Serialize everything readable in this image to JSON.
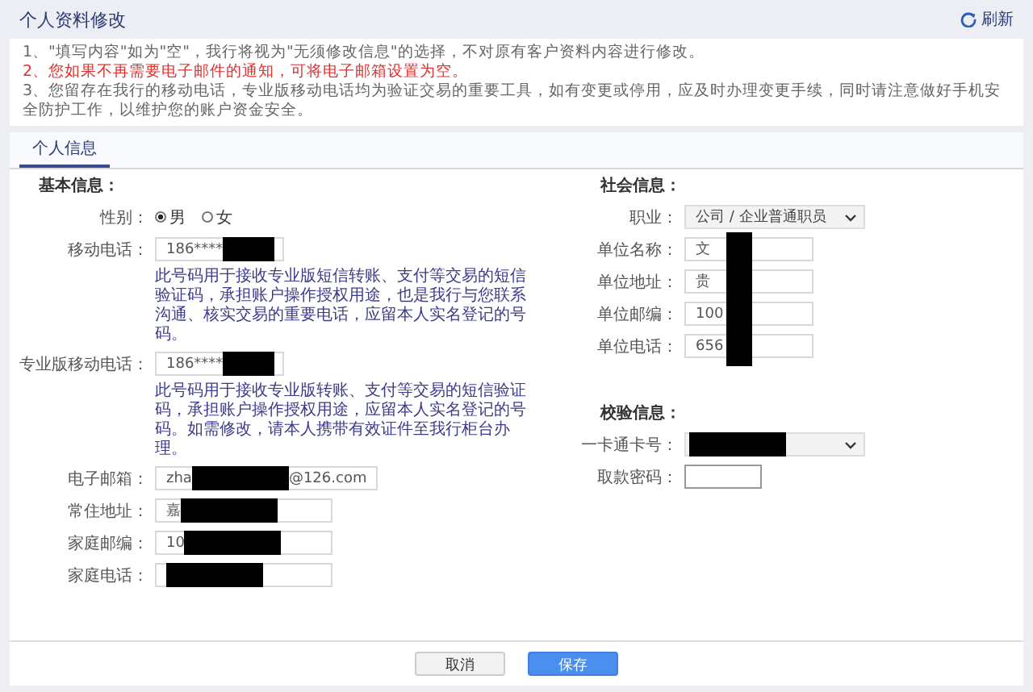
{
  "header": {
    "title": "个人资料修改",
    "refresh": "刷新"
  },
  "notes": [
    {
      "text": "1、\"填写内容\"如为\"空\"，我行将视为\"无须修改信息\"的选择，不对原有客户资料内容进行修改。",
      "kind": "normal"
    },
    {
      "text": "2、您如果不再需要电子邮件的通知，可将电子邮箱设置为空。",
      "kind": "warning"
    },
    {
      "text": "3、您留存在我行的移动电话，专业版移动电话均为验证交易的重要工具，如有变更或停用，应及时办理变更手续，同时请注意做好手机安全防护工作，以维护您的账户资金安全。",
      "kind": "normal"
    }
  ],
  "tabs": [
    {
      "label": "个人信息",
      "selected": true
    }
  ],
  "basic": {
    "heading": "基本信息：",
    "gender": {
      "label": "性别：",
      "options": [
        {
          "label": "男",
          "selected": true
        },
        {
          "label": "女",
          "selected": false
        }
      ]
    },
    "fields": [
      {
        "label": "移动电话：",
        "value": "186****",
        "redacted": true,
        "help": "此号码用于接收专业版短信转账、支付等交易的短信验证码，承担账户操作授权用途，也是我行与您联系沟通、核实交易的重要电话，应留本人实名登记的号码。"
      },
      {
        "label": "专业版移动电话：",
        "value": "186****",
        "redacted": true,
        "help": "此号码用于接收专业版转账、支付等交易的短信验证码，承担账户操作授权用途，应留本人实名登记的号码。如需修改，请本人携带有效证件至我行柜台办理。"
      },
      {
        "label": "电子邮箱：",
        "value": "zha",
        "value_end": "@126.com",
        "redacted": true
      },
      {
        "label": "常住地址：",
        "value": "嘉",
        "redacted": true
      },
      {
        "label": "家庭邮编：",
        "value": "10",
        "redacted": true
      },
      {
        "label": "家庭电话：",
        "redacted": true
      }
    ]
  },
  "social": {
    "heading": "社会信息：",
    "occupation": {
      "label": "职业：",
      "value": "公司 / 企业普通职员"
    },
    "redaction_band": true,
    "fields": [
      {
        "label": "单位名称：",
        "value": "文"
      },
      {
        "label": "单位地址：",
        "value": "贵"
      },
      {
        "label": "单位邮编：",
        "value": "100"
      },
      {
        "label": "单位电话：",
        "value": "656"
      }
    ]
  },
  "verify": {
    "heading": "校验信息：",
    "card": {
      "label": "一卡通卡号：",
      "redacted": true
    },
    "password": {
      "label": "取款密码："
    }
  },
  "buttons": [
    {
      "label": "取消",
      "kind": "secondary"
    },
    {
      "label": "保存",
      "kind": "primary"
    }
  ]
}
